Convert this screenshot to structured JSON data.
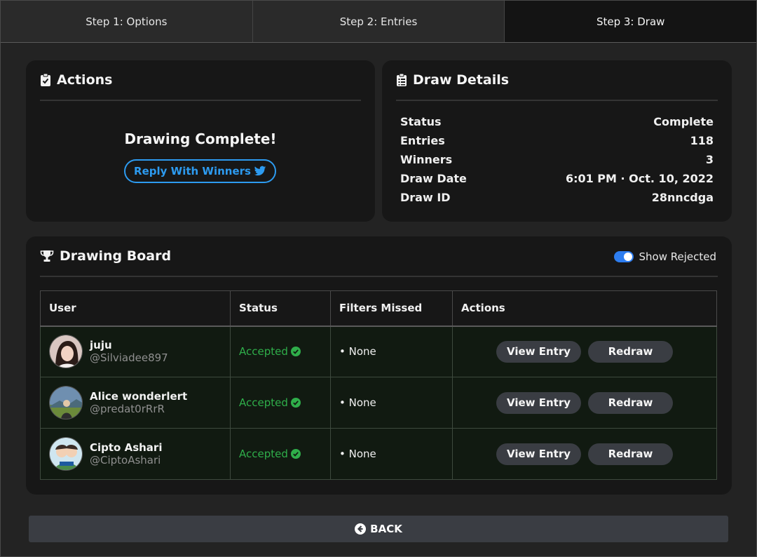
{
  "tabs": [
    {
      "label": "Step 1: Options"
    },
    {
      "label": "Step 2: Entries"
    },
    {
      "label": "Step 3: Draw"
    }
  ],
  "actions": {
    "title": "Actions",
    "complete_text": "Drawing Complete!",
    "reply_label": "Reply With Winners"
  },
  "details": {
    "title": "Draw Details",
    "rows": [
      {
        "label": "Status",
        "value": "Complete"
      },
      {
        "label": "Entries",
        "value": "118"
      },
      {
        "label": "Winners",
        "value": "3"
      },
      {
        "label": "Draw Date",
        "value": "6:01 PM · Oct. 10, 2022"
      },
      {
        "label": "Draw ID",
        "value": "28nncdga"
      }
    ]
  },
  "board": {
    "title": "Drawing Board",
    "toggle_label": "Show Rejected",
    "toggle_on": true,
    "columns": [
      "User",
      "Status",
      "Filters Missed",
      "Actions"
    ],
    "rows": [
      {
        "name": "juju",
        "handle": "@Silviadee897",
        "status": "Accepted",
        "filters": "• None",
        "view_label": "View Entry",
        "redraw_label": "Redraw"
      },
      {
        "name": "Alice wonderlert",
        "handle": "@predat0rRrR",
        "status": "Accepted",
        "filters": "• None",
        "view_label": "View Entry",
        "redraw_label": "Redraw"
      },
      {
        "name": "Cipto Ashari",
        "handle": "@CiptoAshari",
        "status": "Accepted",
        "filters": "• None",
        "view_label": "View Entry",
        "redraw_label": "Redraw"
      }
    ]
  },
  "back_label": "BACK",
  "colors": {
    "accent_blue": "#2d9bf0",
    "accepted_green": "#2fae4a",
    "card_bg": "#171717",
    "page_bg": "#232323"
  },
  "icons": {
    "actions": "clipboard-check-icon",
    "details": "clipboard-list-icon",
    "board": "trophy-icon",
    "reply": "twitter-bird-icon",
    "accepted": "check-circle-icon",
    "back": "arrow-left-circle-icon"
  }
}
